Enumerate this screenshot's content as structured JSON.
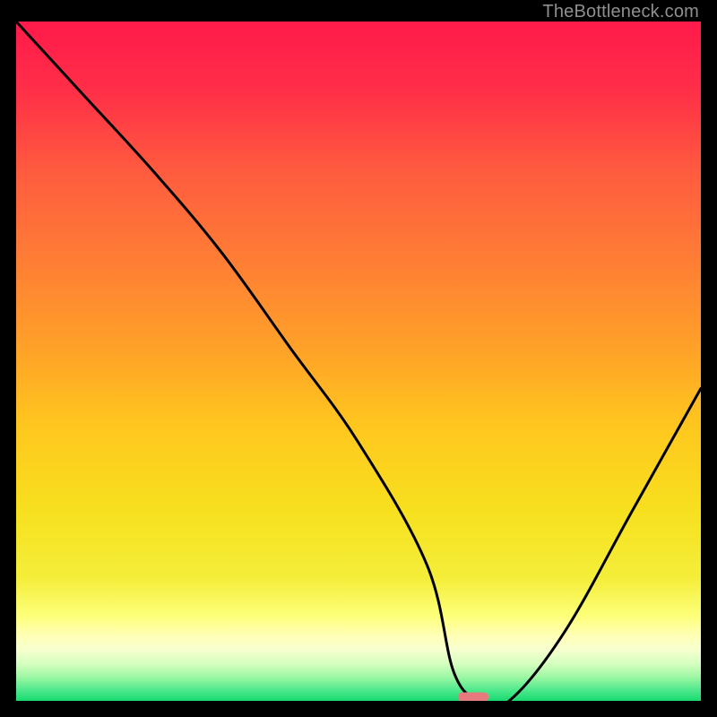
{
  "watermark": "TheBottleneck.com",
  "chart_data": {
    "type": "line",
    "title": "",
    "xlabel": "",
    "ylabel": "",
    "xlim": [
      0,
      100
    ],
    "ylim": [
      0,
      100
    ],
    "x": [
      0,
      10,
      20,
      30,
      40,
      50,
      60,
      64,
      68,
      72,
      80,
      90,
      100
    ],
    "values": [
      100,
      89,
      78,
      66,
      52,
      38,
      20,
      4,
      0,
      0,
      10,
      28,
      46
    ],
    "marker": {
      "x_start": 64.5,
      "x_end": 69,
      "y": 0.6,
      "color": "#e77a7f"
    },
    "gradient_stops": [
      {
        "offset": 0.0,
        "color": "#ff1a4b"
      },
      {
        "offset": 0.1,
        "color": "#ff2e47"
      },
      {
        "offset": 0.22,
        "color": "#ff5b3f"
      },
      {
        "offset": 0.35,
        "color": "#ff7d35"
      },
      {
        "offset": 0.48,
        "color": "#ffa128"
      },
      {
        "offset": 0.6,
        "color": "#ffc81e"
      },
      {
        "offset": 0.72,
        "color": "#f7e01e"
      },
      {
        "offset": 0.82,
        "color": "#f4ee3a"
      },
      {
        "offset": 0.875,
        "color": "#fdff7a"
      },
      {
        "offset": 0.905,
        "color": "#ffffb8"
      },
      {
        "offset": 0.925,
        "color": "#f6ffcf"
      },
      {
        "offset": 0.945,
        "color": "#d6ffc0"
      },
      {
        "offset": 0.965,
        "color": "#9cf7a4"
      },
      {
        "offset": 0.985,
        "color": "#4be88a"
      },
      {
        "offset": 1.0,
        "color": "#18d96f"
      }
    ]
  }
}
